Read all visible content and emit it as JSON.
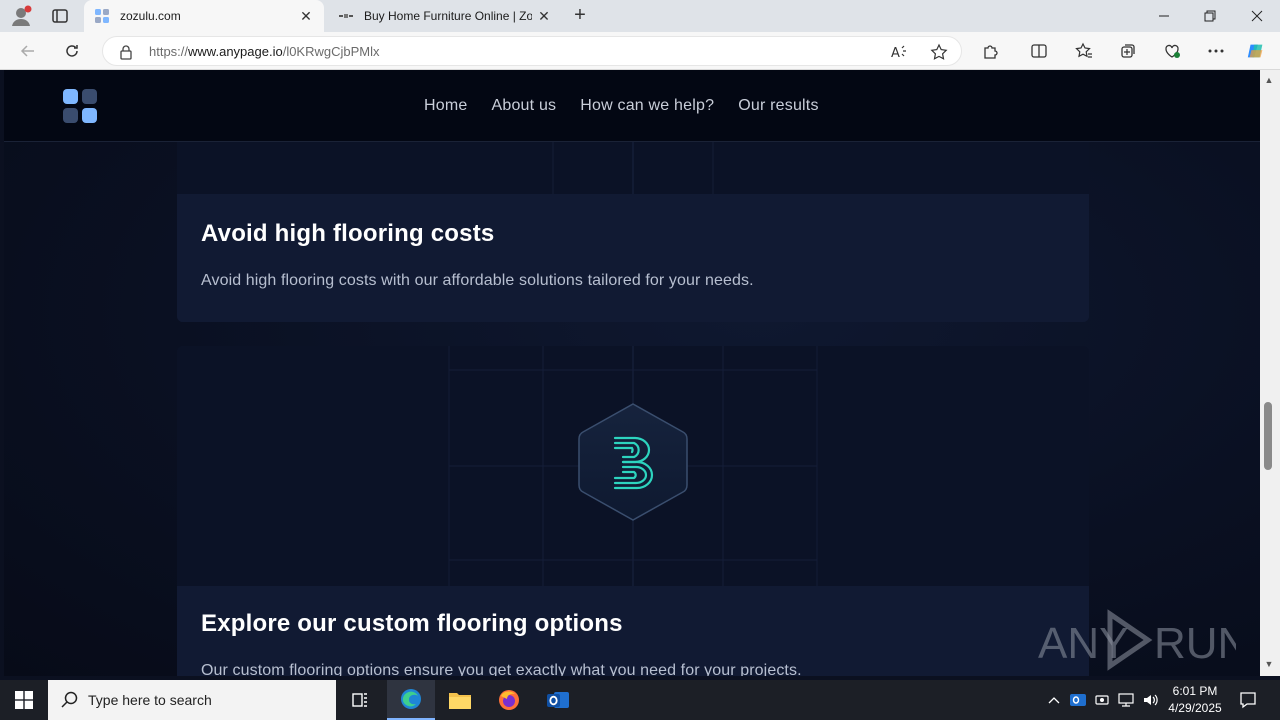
{
  "browser": {
    "tabs": [
      {
        "title": "zozulu.com",
        "active": true
      },
      {
        "title": "Buy Home Furniture Online | Zoz",
        "active": false
      }
    ],
    "url_prefix": "https://",
    "url_host": "www.anypage.io",
    "url_path": "/l0KRwgCjbPMlx"
  },
  "site": {
    "nav": [
      "Home",
      "About us",
      "How can we help?",
      "Our results"
    ],
    "cards": [
      {
        "title": "Avoid high flooring costs",
        "text": "Avoid high flooring costs with our affordable solutions tailored for your needs."
      },
      {
        "title": "Explore our custom flooring options",
        "text": "Our custom flooring options ensure you get exactly what you need for your projects."
      }
    ],
    "colors": {
      "accent": "#2dd4bf",
      "nav_bg": "#030713",
      "card_bg": "#111a33",
      "logo_light": "#7fb7ff",
      "logo_dark": "#3a4c6e"
    }
  },
  "watermark": {
    "left": "ANY",
    "right": "RUN"
  },
  "taskbar": {
    "search_placeholder": "Type here to search",
    "time": "6:01 PM",
    "date": "4/29/2025"
  }
}
